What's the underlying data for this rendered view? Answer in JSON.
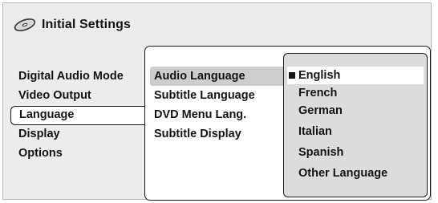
{
  "title": {
    "icon": "disc-icon",
    "text": "Initial Settings"
  },
  "main_menu": {
    "items": [
      {
        "label": "Digital Audio Mode"
      },
      {
        "label": "Video Output"
      },
      {
        "label": "Language",
        "selected": true
      },
      {
        "label": "Display"
      },
      {
        "label": "Options"
      }
    ]
  },
  "sub_menu": {
    "items": [
      {
        "label": "Audio Language",
        "active": true
      },
      {
        "label": "Subtitle Language"
      },
      {
        "label": "DVD Menu Lang."
      },
      {
        "label": "Subtitle Display"
      }
    ]
  },
  "options": {
    "current_marker": "square-bullet-icon",
    "items": [
      {
        "label": "English",
        "current": true
      },
      {
        "label": "French"
      },
      {
        "label": "German"
      },
      {
        "label": "Italian"
      },
      {
        "label": "Spanish"
      },
      {
        "label": "Other Language"
      }
    ]
  }
}
